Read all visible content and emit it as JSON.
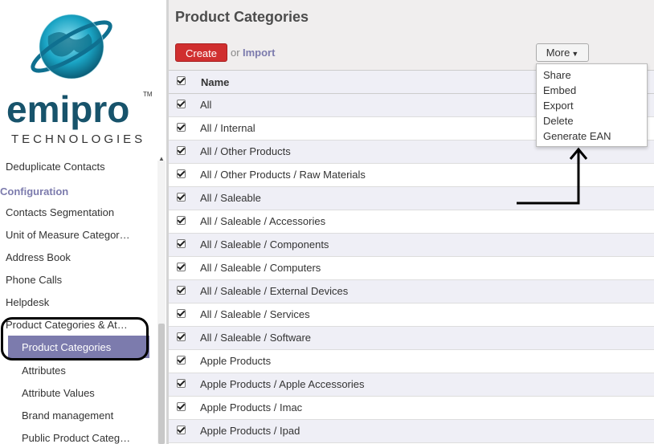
{
  "logo": {
    "brand": "emipro",
    "tm": "TM",
    "tagline": "TECHNOLOGIES"
  },
  "sidebar": {
    "items": [
      {
        "label": "Deduplicate Contacts",
        "level": "item"
      },
      {
        "label": "Configuration",
        "level": "section"
      },
      {
        "label": "Contacts Segmentation",
        "level": "item"
      },
      {
        "label": "Unit of Measure Categor…",
        "level": "item"
      },
      {
        "label": "Address Book",
        "level": "item"
      },
      {
        "label": "Phone Calls",
        "level": "item"
      },
      {
        "label": "Helpdesk",
        "level": "item"
      },
      {
        "label": "Product Categories & At…",
        "level": "item"
      },
      {
        "label": "Product Categories",
        "level": "sub",
        "active": true
      },
      {
        "label": "Attributes",
        "level": "sub"
      },
      {
        "label": "Attribute Values",
        "level": "sub"
      },
      {
        "label": "Brand management",
        "level": "sub"
      },
      {
        "label": "Public Product Categ…",
        "level": "sub"
      }
    ]
  },
  "header": {
    "title": "Product Categories",
    "create_label": "Create",
    "or_text": "or",
    "import_label": "Import",
    "more_label": "More"
  },
  "more_menu": [
    "Share",
    "Embed",
    "Export",
    "Delete",
    "Generate EAN"
  ],
  "table": {
    "column": "Name",
    "rows": [
      "All",
      "All / Internal",
      "All / Other Products",
      "All / Other Products / Raw Materials",
      "All / Saleable",
      "All / Saleable / Accessories",
      "All / Saleable / Components",
      "All / Saleable / Computers",
      "All / Saleable / External Devices",
      "All / Saleable / Services",
      "All / Saleable / Software",
      "Apple Products",
      "Apple Products / Apple Accessories",
      "Apple Products / Imac",
      "Apple Products / Ipad"
    ]
  },
  "colors": {
    "accent": "#7c7bad",
    "create": "#d02f2f",
    "row_alt": "#efeff6"
  }
}
